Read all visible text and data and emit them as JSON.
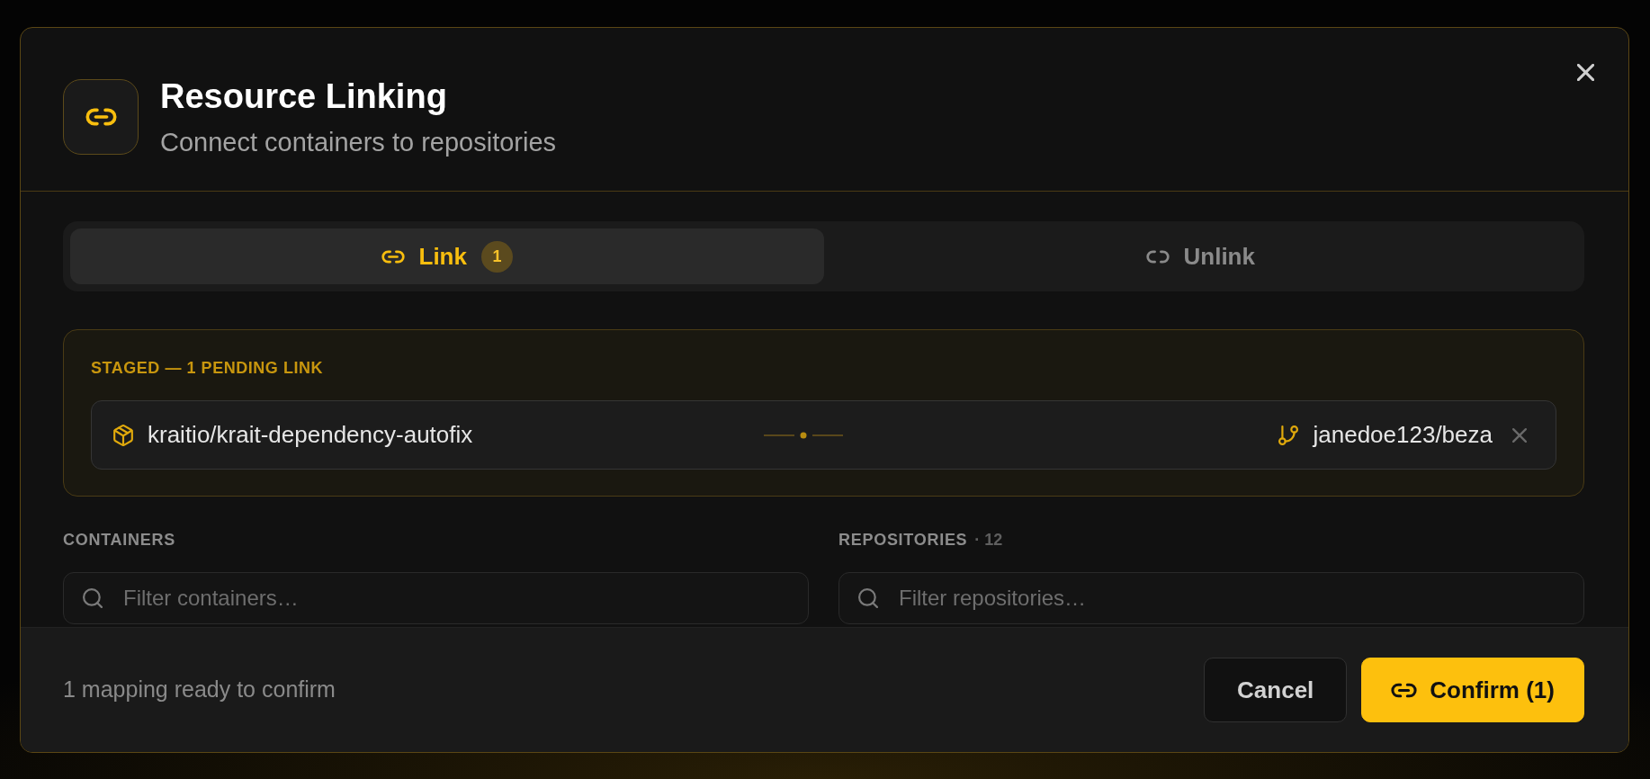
{
  "dialog": {
    "title": "Resource Linking",
    "subtitle": "Connect containers to repositories"
  },
  "tabs": [
    {
      "label": "Link",
      "selected": true,
      "badge": "1"
    },
    {
      "label": "Unlink",
      "selected": false
    }
  ],
  "staged": {
    "heading": "STAGED — 1 PENDING LINK",
    "links": [
      {
        "container": "kraitio/krait-dependency-autofix",
        "repository": "janedoe123/beza"
      }
    ]
  },
  "panels": [
    {
      "label": "CONTAINERS",
      "search": {
        "placeholder": "Filter containers…"
      }
    },
    {
      "label": "REPOSITORIES",
      "count": "· 12",
      "search": {
        "placeholder": "Filter repositories…"
      }
    }
  ],
  "footer": {
    "status": "1 mapping ready to confirm",
    "buttons": [
      {
        "kind": "secondary",
        "label": "Cancel"
      },
      {
        "kind": "primary",
        "label": "Confirm (1)"
      }
    ]
  }
}
